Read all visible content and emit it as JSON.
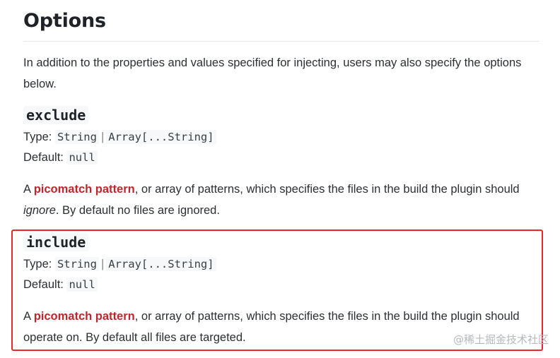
{
  "heading": "Options",
  "intro": "In addition to the properties and values specified for injecting, users may also specify the options below.",
  "options": [
    {
      "name": "exclude",
      "type_label": "Type:",
      "type_values": [
        "String",
        "Array[...String]"
      ],
      "type_separator": "|",
      "default_label": "Default:",
      "default_value": "null",
      "desc_prefix": "A ",
      "link_text": "picomatch pattern",
      "desc_middle": ", or array of patterns, which specifies the files in the build the plugin should ",
      "desc_emphasis": "ignore",
      "desc_suffix": ". By default no files are ignored."
    },
    {
      "name": "include",
      "type_label": "Type:",
      "type_values": [
        "String",
        "Array[...String]"
      ],
      "type_separator": "|",
      "default_label": "Default:",
      "default_value": "null",
      "desc_prefix": "A ",
      "link_text": "picomatch pattern",
      "desc_middle": ", or array of patterns, which specifies the files in the build the plugin should operate on. By default all files are targeted."
    }
  ],
  "highlight_color": "#e8262b",
  "link_color": "#c0262d",
  "watermark": "@稀土掘金技术社区"
}
